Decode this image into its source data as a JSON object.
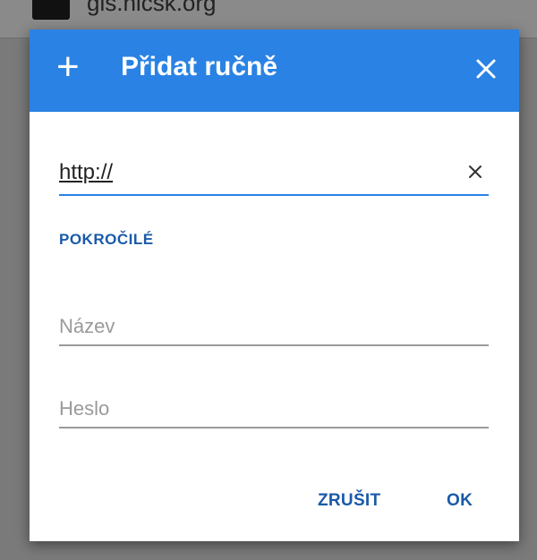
{
  "background": {
    "url_text": "gis.nicsk.org"
  },
  "dialog": {
    "title": "Přidat ručně",
    "header_icon": "plus-icon",
    "close_icon": "close-icon",
    "accent_color": "#2a82e4",
    "url_field": {
      "value": "http://",
      "clear_icon": "clear-icon"
    },
    "advanced_label": "POKROČILÉ",
    "name_field": {
      "placeholder": "Název",
      "value": ""
    },
    "password_field": {
      "placeholder": "Heslo",
      "value": ""
    },
    "buttons": {
      "cancel_label": "ZRUŠIT",
      "ok_label": "OK"
    }
  }
}
